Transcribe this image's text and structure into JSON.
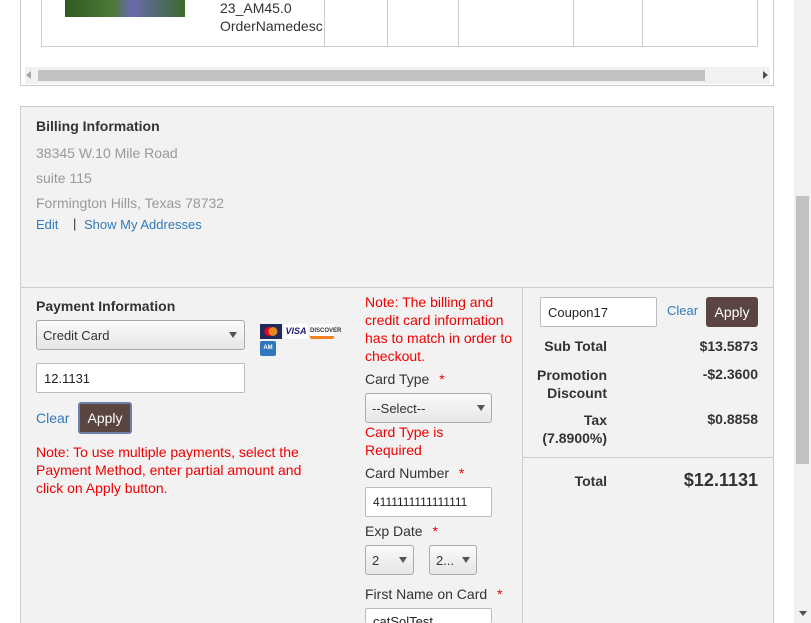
{
  "order_item": {
    "name_line1": "23_AM45.0",
    "name_line2": "OrderNamedesc"
  },
  "billing": {
    "title": "Billing Information",
    "address_line1": "38345 W.10 Mile Road",
    "address_line2": "suite 115",
    "address_line3": "Formington Hills, Texas 78732",
    "edit_label": "Edit",
    "separator": "|",
    "show_addresses_label": "Show My Addresses"
  },
  "payment": {
    "title": "Payment Information",
    "method_selected": "Credit Card",
    "amount_value": "12.1131",
    "clear_label": "Clear",
    "apply_label": "Apply",
    "note": "Note: To use multiple payments, select the Payment Method, enter partial amount and click on Apply button.",
    "card_logos": [
      "MasterCard",
      "VISA",
      "DISCOVER",
      "AMEX"
    ]
  },
  "card_form": {
    "note": "Note: The billing and credit card information has to match in order to checkout.",
    "card_type_label": "Card Type",
    "card_type_selected": "--Select--",
    "card_type_error": "Card Type is Required",
    "card_number_label": "Card Number",
    "card_number_value": "4111111111111111",
    "exp_date_label": "Exp Date",
    "exp_month": "2",
    "exp_year": "2...",
    "first_name_label": "First Name on Card",
    "first_name_value": "catSolTest",
    "required_mark": "*"
  },
  "summary": {
    "coupon_value": "Coupon17",
    "clear_label": "Clear",
    "apply_label": "Apply",
    "subtotal_label": "Sub Total",
    "subtotal_value": "$13.5873",
    "promo_label_1": "Promotion",
    "promo_label_2": "Discount",
    "promo_value": "-$2.3600",
    "tax_label_1": "Tax",
    "tax_label_2": "(7.8900%)",
    "tax_value": "$0.8858",
    "total_label": "Total",
    "total_value": "$12.1131"
  }
}
